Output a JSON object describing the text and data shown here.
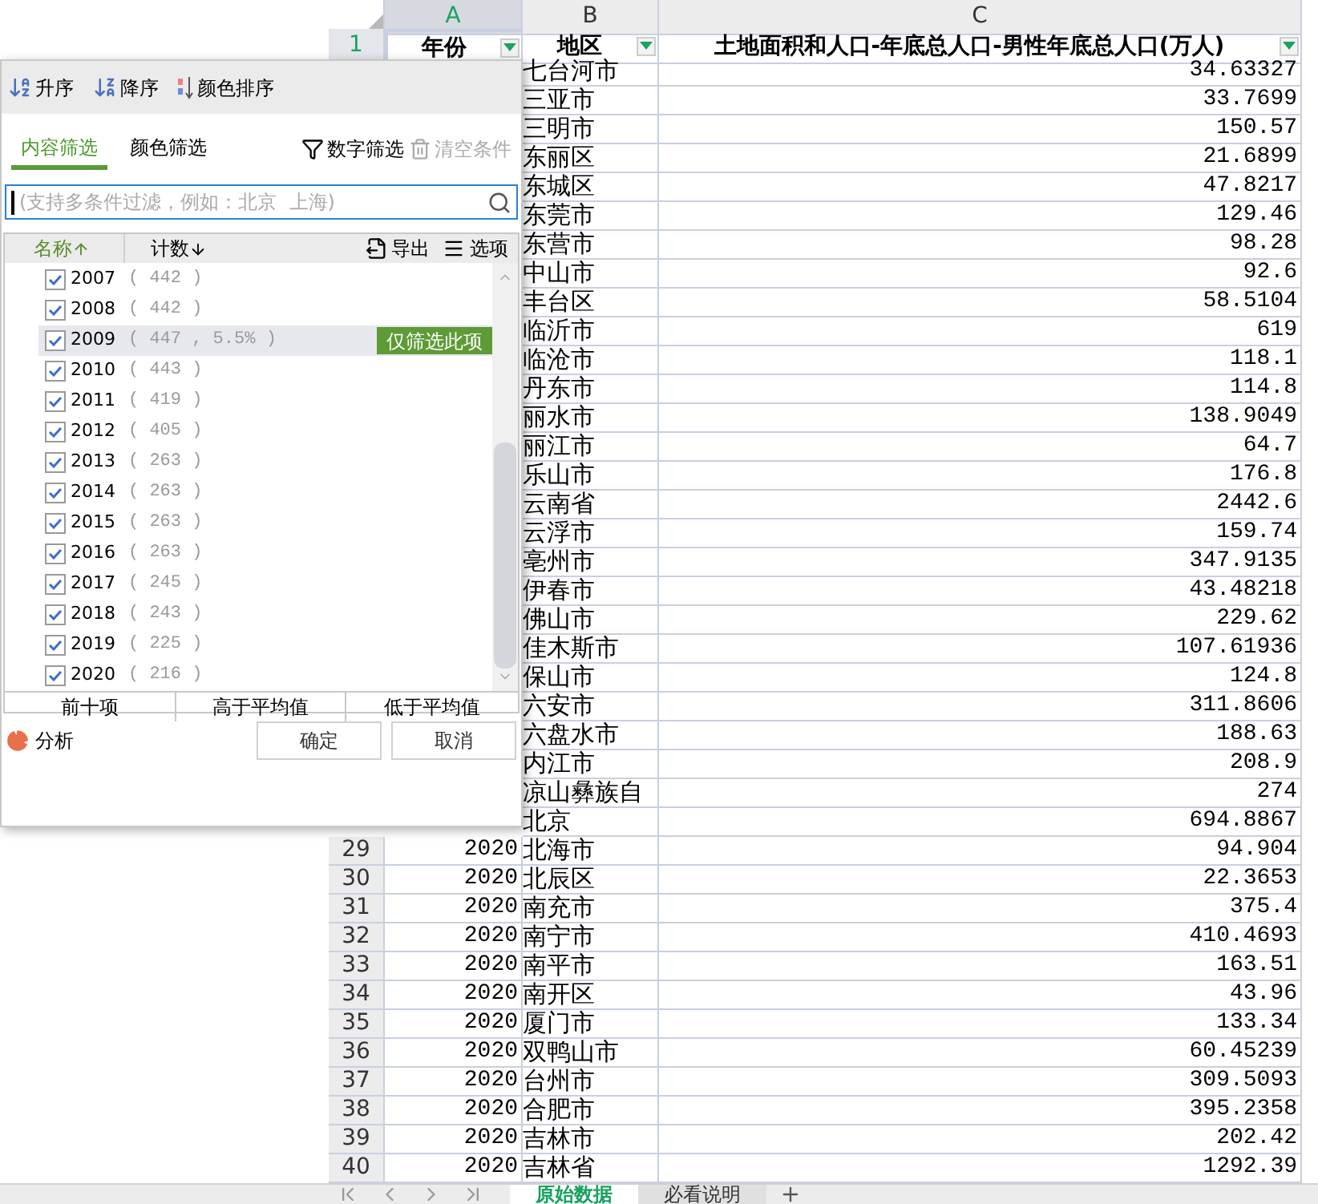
{
  "columns": [
    {
      "label": "A",
      "selected": true
    },
    {
      "label": "B",
      "selected": false
    },
    {
      "label": "C",
      "selected": false
    }
  ],
  "header_row": {
    "row": "1",
    "selected": true,
    "cells": [
      "年份",
      "地区",
      "土地面积和人口-年底总人口-男性年底总人口(万人)"
    ]
  },
  "rows": [
    {
      "region": "七台河市",
      "value": "34.63327"
    },
    {
      "region": "三亚市",
      "value": "33.7699"
    },
    {
      "region": "三明市",
      "value": "150.57"
    },
    {
      "region": "东丽区",
      "value": "21.6899"
    },
    {
      "region": "东城区",
      "value": "47.8217"
    },
    {
      "region": "东莞市",
      "value": "129.46"
    },
    {
      "region": "东营市",
      "value": "98.28"
    },
    {
      "region": "中山市",
      "value": "92.6"
    },
    {
      "region": "丰台区",
      "value": "58.5104"
    },
    {
      "region": "临沂市",
      "value": "619"
    },
    {
      "region": "临沧市",
      "value": "118.1"
    },
    {
      "region": "丹东市",
      "value": "114.8"
    },
    {
      "region": "丽水市",
      "value": "138.9049"
    },
    {
      "region": "丽江市",
      "value": "64.7"
    },
    {
      "region": "乐山市",
      "value": "176.8"
    },
    {
      "region": "云南省",
      "value": "2442.6"
    },
    {
      "region": "云浮市",
      "value": "159.74"
    },
    {
      "region": "亳州市",
      "value": "347.9135"
    },
    {
      "region": "伊春市",
      "value": "43.48218"
    },
    {
      "region": "佛山市",
      "value": "229.62"
    },
    {
      "region": "佳木斯市",
      "value": "107.61936"
    },
    {
      "region": "保山市",
      "value": "124.8"
    },
    {
      "region": "六安市",
      "value": "311.8606"
    },
    {
      "region": "六盘水市",
      "value": "188.63"
    },
    {
      "region": "内江市",
      "value": "208.9"
    },
    {
      "region": "凉山彝族自",
      "value": "274"
    },
    {
      "region": "北京",
      "value": "694.8867"
    },
    {
      "row": "29",
      "year": "2020",
      "region": "北海市",
      "value": "94.904"
    },
    {
      "row": "30",
      "year": "2020",
      "region": "北辰区",
      "value": "22.3653"
    },
    {
      "row": "31",
      "year": "2020",
      "region": "南充市",
      "value": "375.4"
    },
    {
      "row": "32",
      "year": "2020",
      "region": "南宁市",
      "value": "410.4693"
    },
    {
      "row": "33",
      "year": "2020",
      "region": "南平市",
      "value": "163.51"
    },
    {
      "row": "34",
      "year": "2020",
      "region": "南开区",
      "value": "43.96"
    },
    {
      "row": "35",
      "year": "2020",
      "region": "厦门市",
      "value": "133.34"
    },
    {
      "row": "36",
      "year": "2020",
      "region": "双鸭山市",
      "value": "60.45239"
    },
    {
      "row": "37",
      "year": "2020",
      "region": "台州市",
      "value": "309.5093"
    },
    {
      "row": "38",
      "year": "2020",
      "region": "合肥市",
      "value": "395.2358"
    },
    {
      "row": "39",
      "year": "2020",
      "region": "吉林市",
      "value": "202.42"
    },
    {
      "row": "40",
      "year": "2020",
      "region": "吉林省",
      "value": "1292.39"
    }
  ],
  "filter": {
    "sort_buttons": [
      "升序",
      "降序",
      "颜色排序"
    ],
    "tabs": [
      {
        "label": "内容筛选",
        "selected": true
      },
      {
        "label": "颜色筛选",
        "selected": false
      }
    ],
    "number_filter": "数字筛选",
    "clear": {
      "label": "清空条件",
      "disabled": true
    },
    "search": {
      "placeholder": "(支持多条件过滤，例如：北京  上海)"
    },
    "list_header": {
      "name": "名称",
      "count": "计数",
      "export": "导出",
      "options": "选项"
    },
    "items": [
      {
        "label": "2007",
        "count": "( 442 )",
        "checked": true,
        "highlighted": false
      },
      {
        "label": "2008",
        "count": "( 442 )",
        "checked": true,
        "highlighted": false
      },
      {
        "label": "2009",
        "count": "( 447 , 5.5% )",
        "checked": true,
        "highlighted": true
      },
      {
        "label": "2010",
        "count": "( 443 )",
        "checked": true,
        "highlighted": false
      },
      {
        "label": "2011",
        "count": "( 419 )",
        "checked": true,
        "highlighted": false
      },
      {
        "label": "2012",
        "count": "( 405 )",
        "checked": true,
        "highlighted": false
      },
      {
        "label": "2013",
        "count": "( 263 )",
        "checked": true,
        "highlighted": false
      },
      {
        "label": "2014",
        "count": "( 263 )",
        "checked": true,
        "highlighted": false
      },
      {
        "label": "2015",
        "count": "( 263 )",
        "checked": true,
        "highlighted": false
      },
      {
        "label": "2016",
        "count": "( 263 )",
        "checked": true,
        "highlighted": false
      },
      {
        "label": "2017",
        "count": "( 245 )",
        "checked": true,
        "highlighted": false
      },
      {
        "label": "2018",
        "count": "( 243 )",
        "checked": true,
        "highlighted": false
      },
      {
        "label": "2019",
        "count": "( 225 )",
        "checked": true,
        "highlighted": false
      },
      {
        "label": "2020",
        "count": "( 216 )",
        "checked": true,
        "highlighted": false
      }
    ],
    "only_this": "仅筛选此项",
    "quick_buttons": [
      "前十项",
      "高于平均值",
      "低于平均值"
    ],
    "analysis": "分析",
    "ok": "确定",
    "cancel": "取消"
  },
  "sheet_tabs": [
    {
      "label": "原始数据",
      "selected": true
    },
    {
      "label": "必看说明",
      "selected": false
    }
  ]
}
